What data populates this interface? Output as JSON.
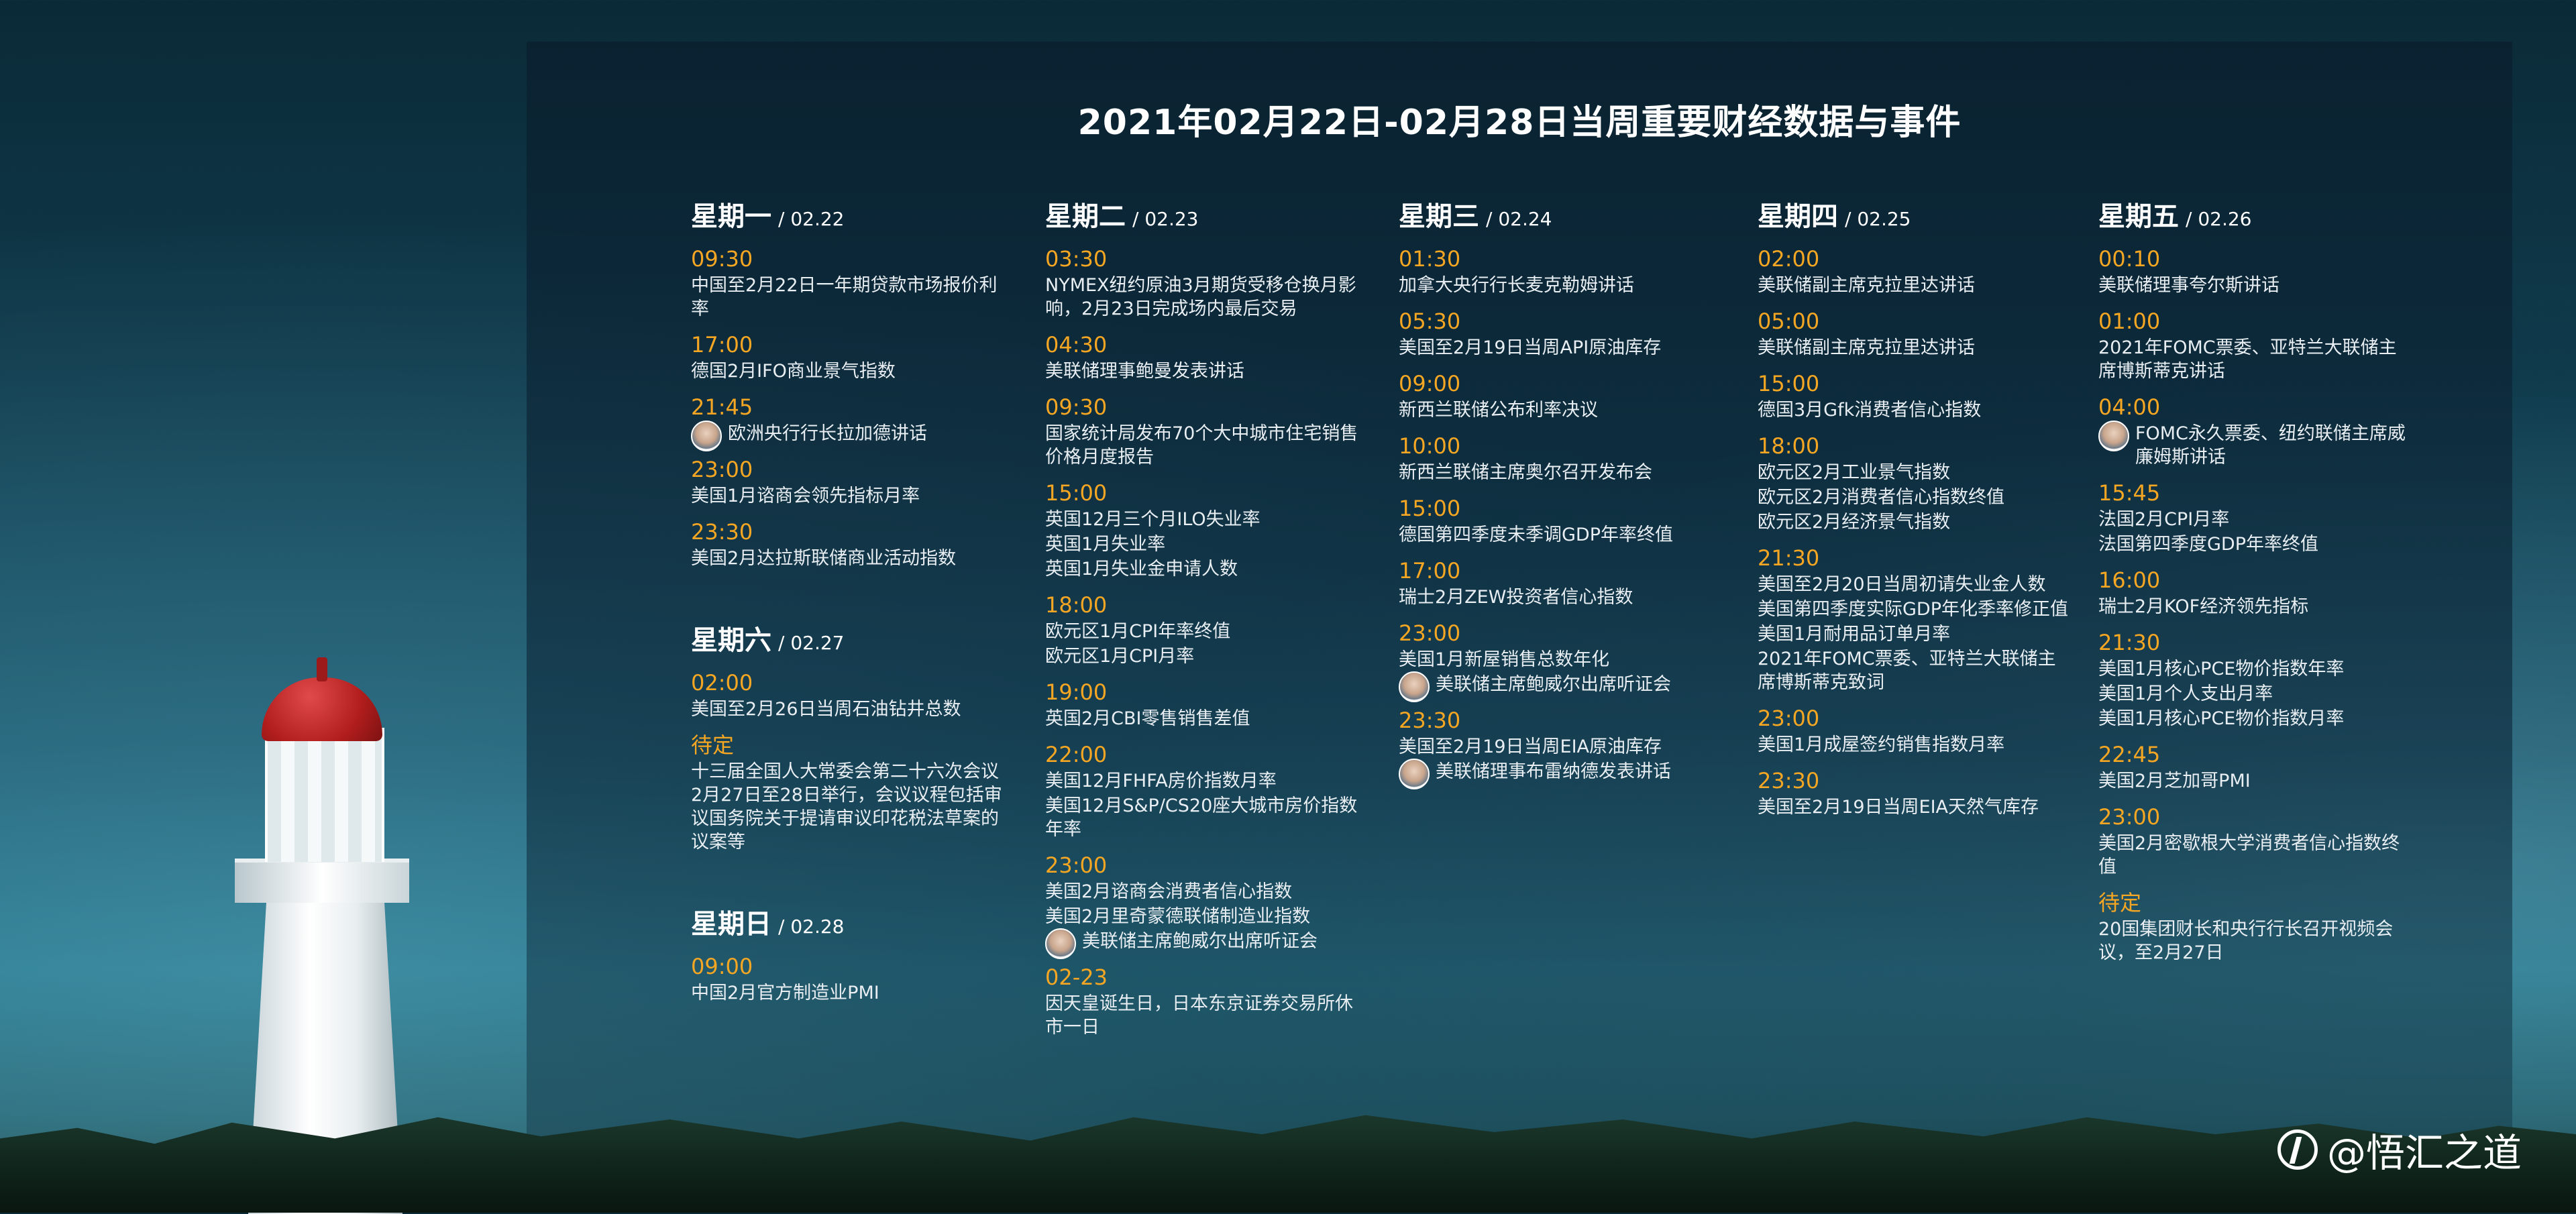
{
  "title": "2021年02月22日-02月28日当周重要财经数据与事件",
  "watermark": "@悟汇之道",
  "colors": {
    "time": "#f5a623",
    "text": "#e8eef2",
    "heading": "#ffffff"
  },
  "days": {
    "mon": {
      "name": "星期一",
      "date": "/ 02.22",
      "events": [
        {
          "time": "09:30",
          "items": [
            "中国至2月22日一年期贷款市场报价利率"
          ]
        },
        {
          "time": "17:00",
          "items": [
            "德国2月IFO商业景气指数"
          ]
        },
        {
          "time": "21:45",
          "items": [
            "欧洲央行行长拉加德讲话"
          ]
        },
        {
          "time": "23:00",
          "items": [
            "美国1月谘商会领先指标月率"
          ]
        },
        {
          "time": "23:30",
          "items": [
            "美国2月达拉斯联储商业活动指数"
          ]
        }
      ]
    },
    "sat": {
      "name": "星期六",
      "date": "/ 02.27",
      "events": [
        {
          "time": "02:00",
          "items": [
            "美国至2月26日当周石油钻井总数"
          ]
        },
        {
          "time": "待定",
          "items": [
            "十三届全国人大常委会第二十六次会议2月27日至28日举行，会议议程包括审议国务院关于提请审议印花税法草案的议案等"
          ]
        }
      ]
    },
    "sun": {
      "name": "星期日",
      "date": "/ 02.28",
      "events": [
        {
          "time": "09:00",
          "items": [
            "中国2月官方制造业PMI"
          ]
        }
      ]
    },
    "tue": {
      "name": "星期二",
      "date": "/ 02.23",
      "events": [
        {
          "time": "03:30",
          "items": [
            "NYMEX纽约原油3月期货受移仓换月影响，2月23日完成场内最后交易"
          ]
        },
        {
          "time": "04:30",
          "items": [
            "美联储理事鲍曼发表讲话"
          ]
        },
        {
          "time": "09:30",
          "items": [
            "国家统计局发布70个大中城市住宅销售价格月度报告"
          ]
        },
        {
          "time": "15:00",
          "items": [
            "英国12月三个月ILO失业率",
            "英国1月失业率",
            "英国1月失业金申请人数"
          ]
        },
        {
          "time": "18:00",
          "items": [
            "欧元区1月CPI年率终值",
            "欧元区1月CPI月率"
          ]
        },
        {
          "time": "19:00",
          "items": [
            "英国2月CBI零售销售差值"
          ]
        },
        {
          "time": "22:00",
          "items": [
            "美国12月FHFA房价指数月率",
            "美国12月S&P/CS20座大城市房价指数年率"
          ]
        },
        {
          "time": "23:00",
          "items": [
            "美国2月谘商会消费者信心指数",
            "美国2月里奇蒙德联储制造业指数",
            "美联储主席鲍威尔出席听证会"
          ]
        },
        {
          "time": "02-23",
          "items": [
            "因天皇诞生日，日本东京证券交易所休市一日"
          ]
        }
      ]
    },
    "wed": {
      "name": "星期三",
      "date": "/ 02.24",
      "events": [
        {
          "time": "01:30",
          "items": [
            "加拿大央行行长麦克勒姆讲话"
          ]
        },
        {
          "time": "05:30",
          "items": [
            "美国至2月19日当周API原油库存"
          ]
        },
        {
          "time": "09:00",
          "items": [
            "新西兰联储公布利率决议"
          ]
        },
        {
          "time": "10:00",
          "items": [
            "新西兰联储主席奥尔召开发布会"
          ]
        },
        {
          "time": "15:00",
          "items": [
            "德国第四季度未季调GDP年率终值"
          ]
        },
        {
          "time": "17:00",
          "items": [
            "瑞士2月ZEW投资者信心指数"
          ]
        },
        {
          "time": "23:00",
          "items": [
            "美国1月新屋销售总数年化",
            "美联储主席鲍威尔出席听证会"
          ]
        },
        {
          "time": "23:30",
          "items": [
            "美国至2月19日当周EIA原油库存",
            "美联储理事布雷纳德发表讲话"
          ]
        }
      ]
    },
    "thu": {
      "name": "星期四",
      "date": "/ 02.25",
      "events": [
        {
          "time": "02:00",
          "items": [
            "美联储副主席克拉里达讲话"
          ]
        },
        {
          "time": "05:00",
          "items": [
            "美联储副主席克拉里达讲话"
          ]
        },
        {
          "time": "15:00",
          "items": [
            "德国3月Gfk消费者信心指数"
          ]
        },
        {
          "time": "18:00",
          "items": [
            "欧元区2月工业景气指数",
            "欧元区2月消费者信心指数终值",
            "欧元区2月经济景气指数"
          ]
        },
        {
          "time": "21:30",
          "items": [
            "美国至2月20日当周初请失业金人数",
            "美国第四季度实际GDP年化季率修正值",
            "美国1月耐用品订单月率",
            "2021年FOMC票委、亚特兰大联储主席博斯蒂克致词"
          ]
        },
        {
          "time": "23:00",
          "items": [
            "美国1月成屋签约销售指数月率"
          ]
        },
        {
          "time": "23:30",
          "items": [
            "美国至2月19日当周EIA天然气库存"
          ]
        }
      ]
    },
    "fri": {
      "name": "星期五",
      "date": "/ 02.26",
      "events": [
        {
          "time": "00:10",
          "items": [
            "美联储理事夸尔斯讲话"
          ]
        },
        {
          "time": "01:00",
          "items": [
            "2021年FOMC票委、亚特兰大联储主席博斯蒂克讲话"
          ]
        },
        {
          "time": "04:00",
          "items": [
            "FOMC永久票委、纽约联储主席威廉姆斯讲话"
          ]
        },
        {
          "time": "15:45",
          "items": [
            "法国2月CPI月率",
            "法国第四季度GDP年率终值"
          ]
        },
        {
          "time": "16:00",
          "items": [
            "瑞士2月KOF经济领先指标"
          ]
        },
        {
          "time": "21:30",
          "items": [
            "美国1月核心PCE物价指数年率",
            "美国1月个人支出月率",
            "美国1月核心PCE物价指数月率"
          ]
        },
        {
          "time": "22:45",
          "items": [
            "美国2月芝加哥PMI"
          ]
        },
        {
          "time": "23:00",
          "items": [
            "美国2月密歇根大学消费者信心指数终值"
          ]
        },
        {
          "time": "待定",
          "items": [
            "20国集团财长和央行行长召开视频会议，至2月27日"
          ]
        }
      ]
    }
  }
}
